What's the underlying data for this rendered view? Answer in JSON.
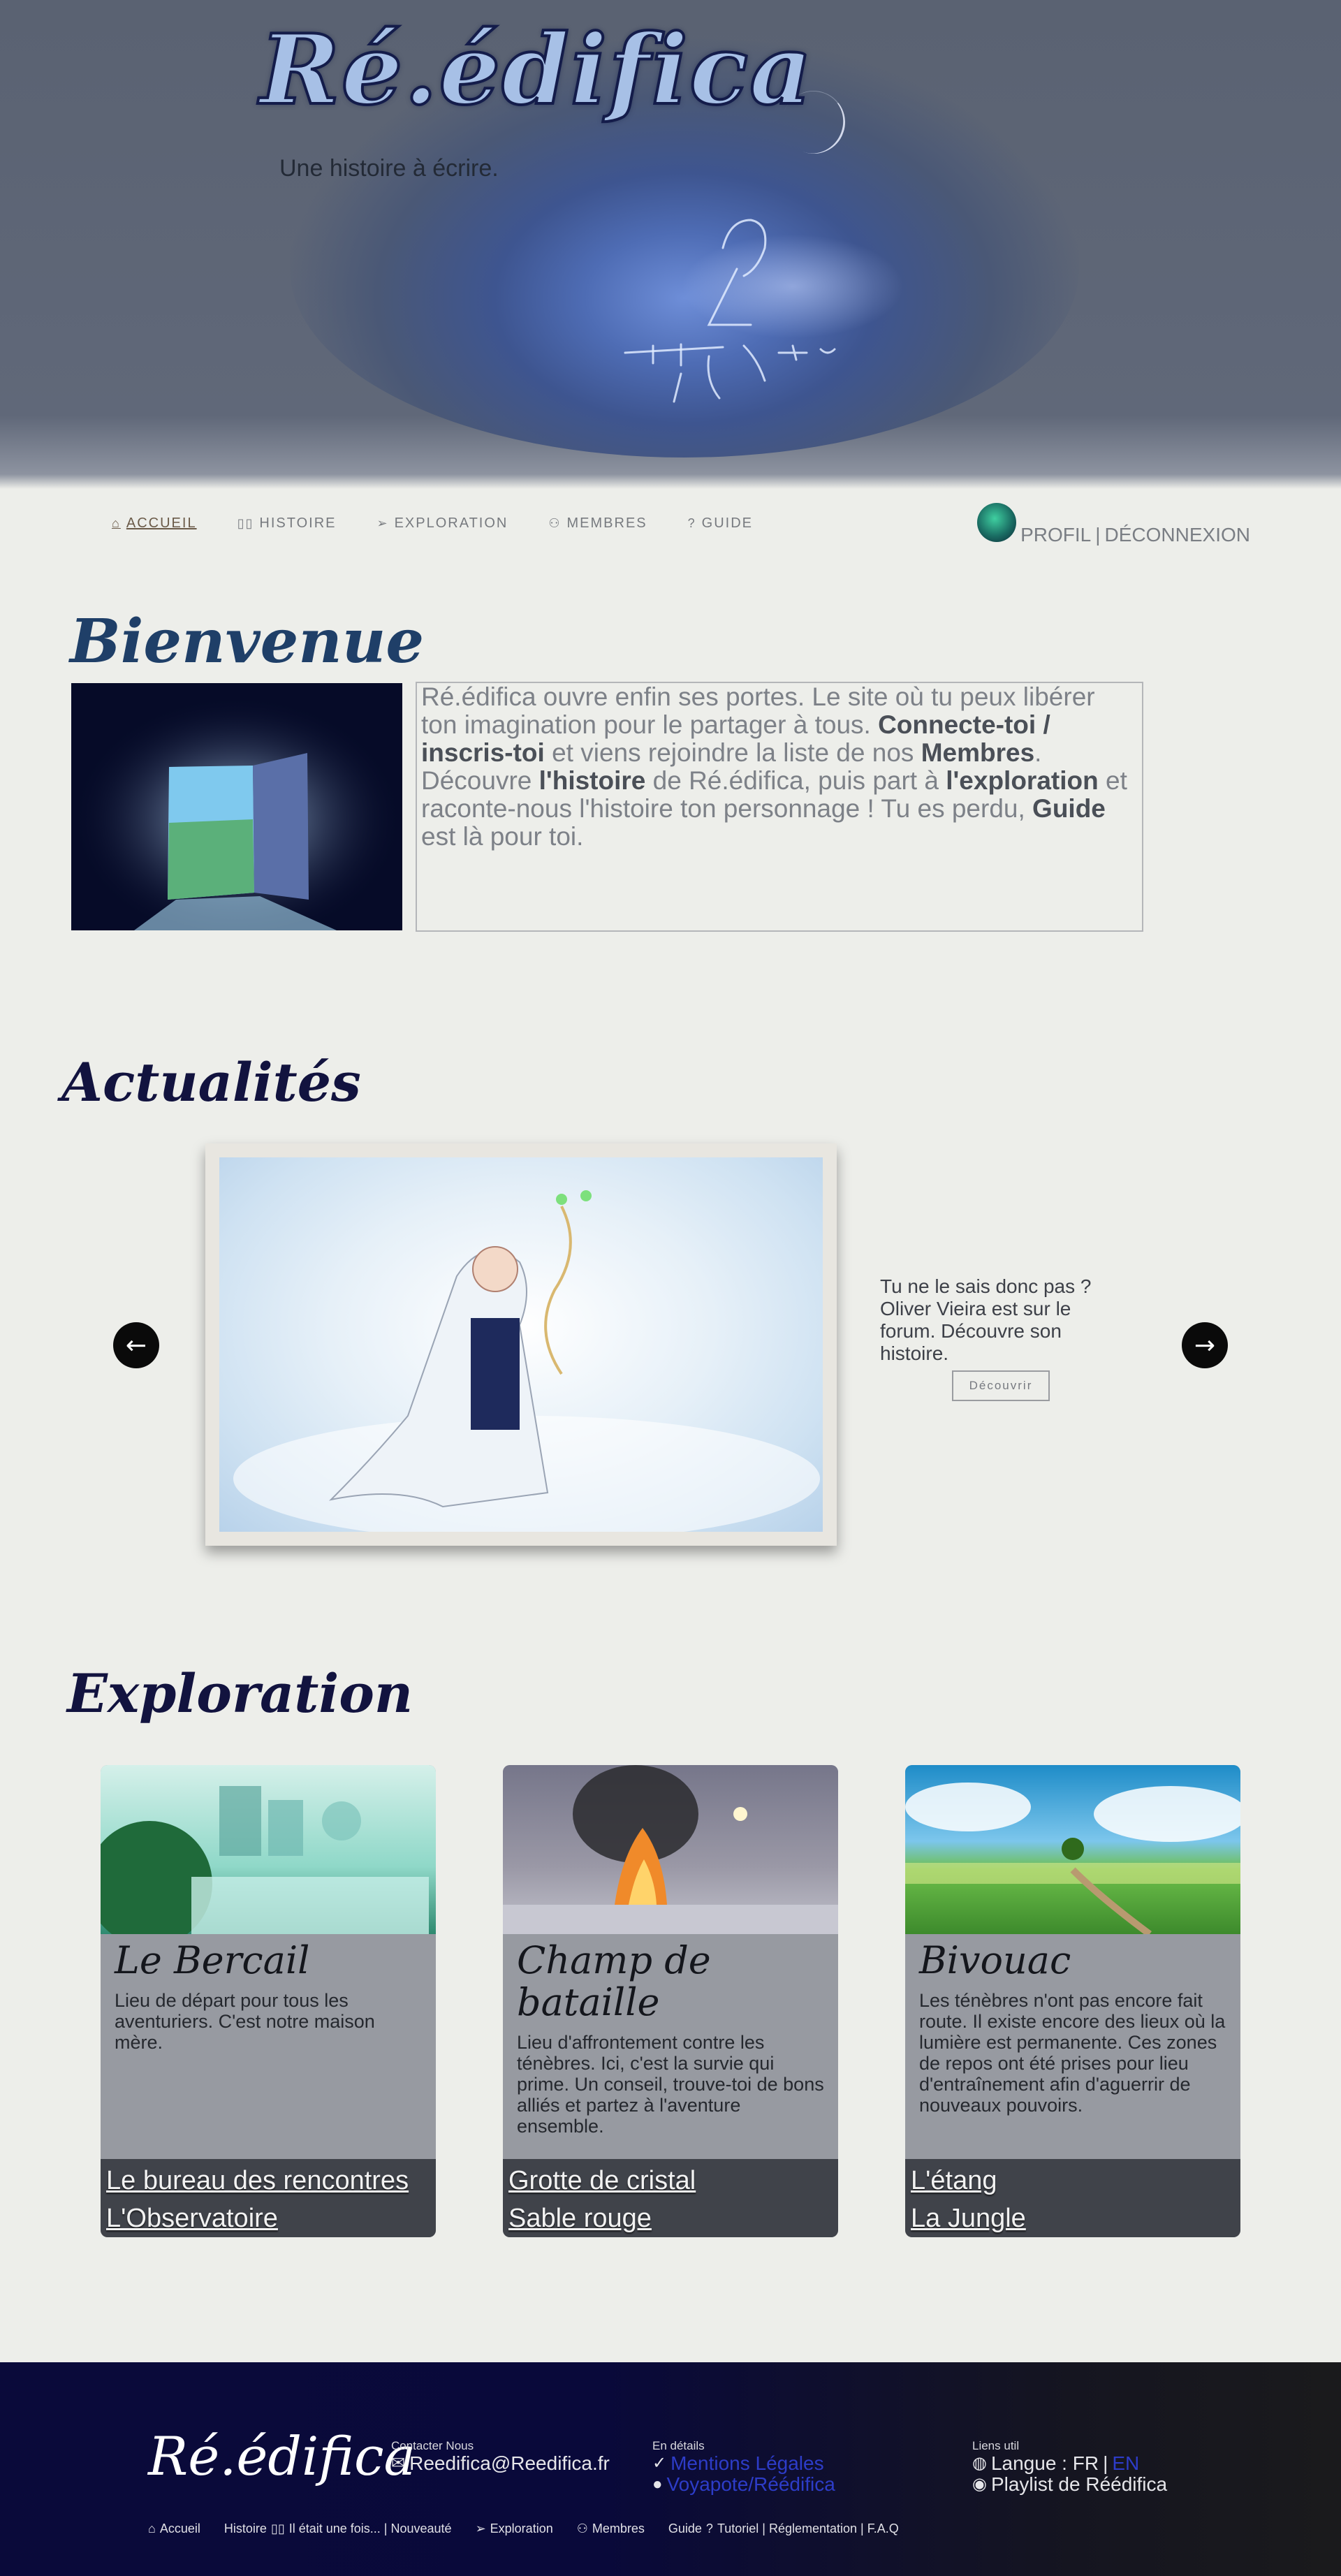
{
  "header": {
    "logo": "Ré.édifica",
    "tagline": "Une histoire à écrire."
  },
  "nav": {
    "items": [
      {
        "label": "ACCUEIL",
        "icon": "home-icon"
      },
      {
        "label": "HISTOIRE",
        "icon": "book-icon"
      },
      {
        "label": "EXPLORATION",
        "icon": "paper-plane-icon"
      },
      {
        "label": "MEMBRES",
        "icon": "users-icon"
      },
      {
        "label": "GUIDE",
        "icon": "question-icon"
      }
    ],
    "profile_label": "PROFIL",
    "separator": "|",
    "logout_label": "DÉCONNEXION"
  },
  "welcome": {
    "title": "Bienvenue",
    "t1": "Ré.édifica ouvre enfin ses portes. Le site où tu peux libérer ton imagination pour le partager à tous. ",
    "b1": "Connecte-toi / inscris-toi",
    "t2": " et viens rejoindre la liste de nos ",
    "b2": "Membres",
    "t3": ". Découvre ",
    "b3": "l'histoire",
    "t4": " de Ré.édifica, puis part à ",
    "b4": "l'exploration",
    "t5": " et raconte-nous l'histoire ton personnage ! Tu es perdu, ",
    "b5": "Guide",
    "t6": " est là pour toi."
  },
  "news": {
    "title": "Actualités",
    "text": "Tu ne le sais donc pas ? Oliver Vieira est sur le forum. Découvre son histoire.",
    "button": "Découvrir"
  },
  "exploration": {
    "title": "Exploration",
    "cards": [
      {
        "title": "Le Bercail",
        "desc": "Lieu de départ pour tous les aventuriers. C'est notre maison mère.",
        "links": [
          "Le bureau des rencontres",
          "L'Observatoire"
        ]
      },
      {
        "title": "Champ de bataille",
        "desc": "Lieu d'affrontement contre les ténèbres. Ici, c'est la survie qui prime. Un conseil, trouve-toi de bons alliés et partez à l'aventure ensemble.",
        "links": [
          "Grotte de cristal",
          "Sable rouge"
        ]
      },
      {
        "title": "Bivouac",
        "desc": "Les ténèbres n'ont pas encore fait route. Il existe encore des lieux où la lumière est permanente. Ces zones de repos ont été prises pour lieu d'entraînement afin d'aguerrir de nouveaux pouvoirs.",
        "links": [
          "L'étang",
          "La Jungle"
        ]
      }
    ]
  },
  "footer": {
    "logo": "Ré.édifica",
    "contact_label": "Contacter Nous",
    "email": "Reedifica@Reedifica.fr",
    "details_label": "En détails",
    "legal": "Mentions Légales",
    "github": "Voyapote/Réédifica",
    "links_label": "Liens util",
    "lang_prefix": "Langue : FR",
    "lang_sep": "|",
    "lang_en": "EN",
    "playlist": "Playlist de Réédifica",
    "nav": {
      "accueil": "Accueil",
      "histoire": "Histoire",
      "histoire_sub": "Il était une fois... | Nouveauté",
      "exploration": "Exploration",
      "membres": "Membres",
      "guide": "Guide",
      "guide_sub": "Tutoriel | Réglementation | F.A.Q"
    }
  },
  "colors": {
    "accent": "#12133f",
    "footer_bg": "#0a0a3a",
    "link_blue": "#2d3cc8",
    "card_bg": "#979aa1",
    "card_links_bg": "#40434a"
  }
}
